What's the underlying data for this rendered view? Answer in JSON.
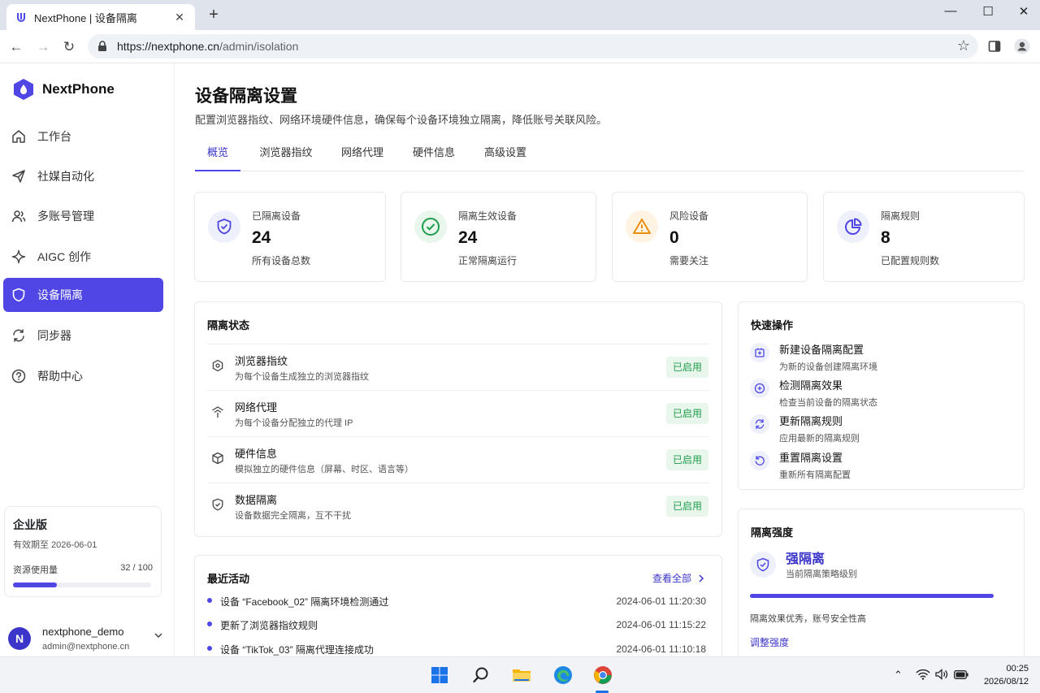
{
  "browser": {
    "tab_title": "NextPhone | 设备隔离",
    "url_host": "https://nextphone.cn",
    "url_path": "/admin/isolation",
    "new_tab": "+",
    "tab_close": "✕"
  },
  "sidebar": {
    "brand": "NextPhone",
    "items": [
      {
        "label": "工作台",
        "icon": "home-icon"
      },
      {
        "label": "社媒自动化",
        "icon": "send-icon"
      },
      {
        "label": "多账号管理",
        "icon": "users-icon"
      },
      {
        "label": "AIGC 创作",
        "icon": "sparkle-icon"
      },
      {
        "label": "设备隔离",
        "icon": "shield-icon",
        "active": true
      },
      {
        "label": "同步器",
        "icon": "sync-icon"
      },
      {
        "label": "帮助中心",
        "icon": "help-icon"
      }
    ],
    "plan": {
      "name": "企业版",
      "expiry": "有效期至 2026-06-01",
      "usage_label": "资源使用量",
      "usage_text": "32 / 100",
      "usage_fraction": 0.32
    },
    "user": {
      "initial": "N",
      "name": "nextphone_demo",
      "email": "admin@nextphone.cn"
    }
  },
  "main": {
    "title": "设备隔离设置",
    "description": "配置浏览器指纹、网络环境硬件信息，确保每个设备环境独立隔离，降低账号关联风险。",
    "tabs": [
      "概览",
      "浏览器指纹",
      "网络代理",
      "硬件信息",
      "高级设置"
    ],
    "active_tab": 0,
    "stats": [
      {
        "label": "已隔离设备",
        "value": "24",
        "sub": "所有设备总数",
        "icon": "shield-icon",
        "color": "#4f46e5"
      },
      {
        "label": "隔离生效设备",
        "value": "24",
        "sub": "正常隔离运行",
        "icon": "check-circle-icon",
        "color": "#1f9d4c"
      },
      {
        "label": "风险设备",
        "value": "0",
        "sub": "需要关注",
        "icon": "warning-icon",
        "color": "#e8900c"
      },
      {
        "label": "隔离规则",
        "value": "8",
        "sub": "已配置规则数",
        "icon": "pie-chart-icon",
        "color": "#4f46e5"
      }
    ],
    "isolation_status": {
      "title": "隔离状态",
      "rows": [
        {
          "title": "浏览器指纹",
          "desc": "为每个设备生成独立的浏览器指纹",
          "status": "已启用",
          "icon": "fingerprint-icon"
        },
        {
          "title": "网络代理",
          "desc": "为每个设备分配独立的代理 IP",
          "status": "已启用",
          "icon": "proxy-icon"
        },
        {
          "title": "硬件信息",
          "desc": "模拟独立的硬件信息（屏幕、时区、语言等）",
          "status": "已启用",
          "icon": "cube-icon"
        },
        {
          "title": "数据隔离",
          "desc": "设备数据完全隔离，互不干扰",
          "status": "已启用",
          "icon": "shield-check-icon"
        }
      ]
    },
    "recent": {
      "title": "最近活动",
      "view_all": "查看全部",
      "items": [
        {
          "text": "设备 “Facebook_02” 隔离环境检测通过",
          "time": "2024-06-01 11:20:30"
        },
        {
          "text": "更新了浏览器指纹规则",
          "time": "2024-06-01 11:15:22"
        },
        {
          "text": "设备 “TikTok_03” 隔离代理连接成功",
          "time": "2024-06-01 11:10:18"
        }
      ]
    },
    "quick_actions": {
      "title": "快速操作",
      "items": [
        {
          "title": "新建设备隔离配置",
          "desc": "为新的设备创建隔离环境",
          "icon": "add-device-icon"
        },
        {
          "title": "检测隔离效果",
          "desc": "检查当前设备的隔离状态",
          "icon": "plus-circle-icon"
        },
        {
          "title": "更新隔离规则",
          "desc": "应用最新的隔离规则",
          "icon": "refresh-icon"
        },
        {
          "title": "重置隔离设置",
          "desc": "重新所有隔离配置",
          "icon": "reset-icon"
        }
      ]
    },
    "strength": {
      "title": "隔离强度",
      "level": "强隔离",
      "level_desc": "当前隔离策略级别",
      "fraction": 1.0,
      "summary": "隔离效果优秀，账号安全性高",
      "adjust": "调整强度"
    }
  },
  "taskbar": {
    "time": "00:25",
    "date": "2026/08/12"
  }
}
